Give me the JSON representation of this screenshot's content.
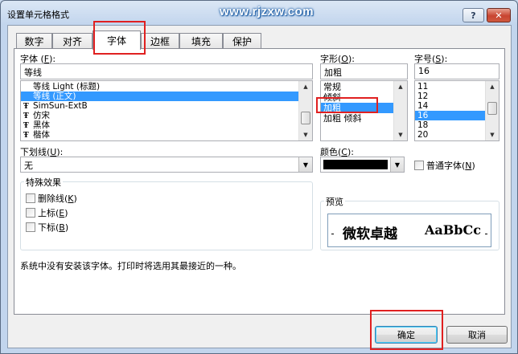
{
  "window": {
    "title": "设置单元格格式",
    "watermark": "www.rjzxw.com",
    "help_glyph": "?",
    "close_glyph": "✕"
  },
  "tabs": [
    {
      "label": "数字",
      "active": false
    },
    {
      "label": "对齐",
      "active": false
    },
    {
      "label": "字体",
      "active": true
    },
    {
      "label": "边框",
      "active": false
    },
    {
      "label": "填充",
      "active": false
    },
    {
      "label": "保护",
      "active": false
    }
  ],
  "font": {
    "label": "字体",
    "hotkey": "F",
    "value": "等线",
    "items": [
      {
        "text": "等线 Light (标题)",
        "truetype": false,
        "selected": false
      },
      {
        "text": "等线 (正文)",
        "truetype": false,
        "selected": true
      },
      {
        "text": "SimSun-ExtB",
        "truetype": true,
        "selected": false
      },
      {
        "text": "仿宋",
        "truetype": true,
        "selected": false
      },
      {
        "text": "黑体",
        "truetype": true,
        "selected": false
      },
      {
        "text": "楷体",
        "truetype": true,
        "selected": false
      }
    ]
  },
  "style": {
    "label": "字形",
    "hotkey": "O",
    "value": "加粗",
    "items": [
      {
        "text": "常规",
        "selected": false
      },
      {
        "text": "倾斜",
        "selected": false
      },
      {
        "text": "加粗",
        "selected": true
      },
      {
        "text": "加粗 倾斜",
        "selected": false
      }
    ]
  },
  "size": {
    "label": "字号",
    "hotkey": "S",
    "value": "16",
    "items": [
      {
        "text": "11",
        "selected": false
      },
      {
        "text": "12",
        "selected": false
      },
      {
        "text": "14",
        "selected": false
      },
      {
        "text": "16",
        "selected": true
      },
      {
        "text": "18",
        "selected": false
      },
      {
        "text": "20",
        "selected": false
      }
    ]
  },
  "underline": {
    "label": "下划线",
    "hotkey": "U",
    "value": "无"
  },
  "color": {
    "label": "颜色",
    "hotkey": "C",
    "value": "#000000"
  },
  "normal_font": {
    "label": "普通字体",
    "hotkey": "N",
    "checked": false
  },
  "effects": {
    "label": "特殊效果",
    "items": [
      {
        "label": "删除线",
        "hotkey": "K",
        "checked": false
      },
      {
        "label": "上标",
        "hotkey": "E",
        "checked": false
      },
      {
        "label": "下标",
        "hotkey": "B",
        "checked": false
      }
    ]
  },
  "preview": {
    "label": "预览",
    "sample_cn": "微软卓越",
    "sample_en": "AaBbCc"
  },
  "info_text": "系统中没有安装该字体。打印时将选用其最接近的一种。",
  "buttons": {
    "ok": "确定",
    "cancel": "取消"
  },
  "icons": {
    "dropdown": "▼",
    "scroll_up": "▲",
    "scroll_down": "▼",
    "truetype": "Ŧ"
  }
}
